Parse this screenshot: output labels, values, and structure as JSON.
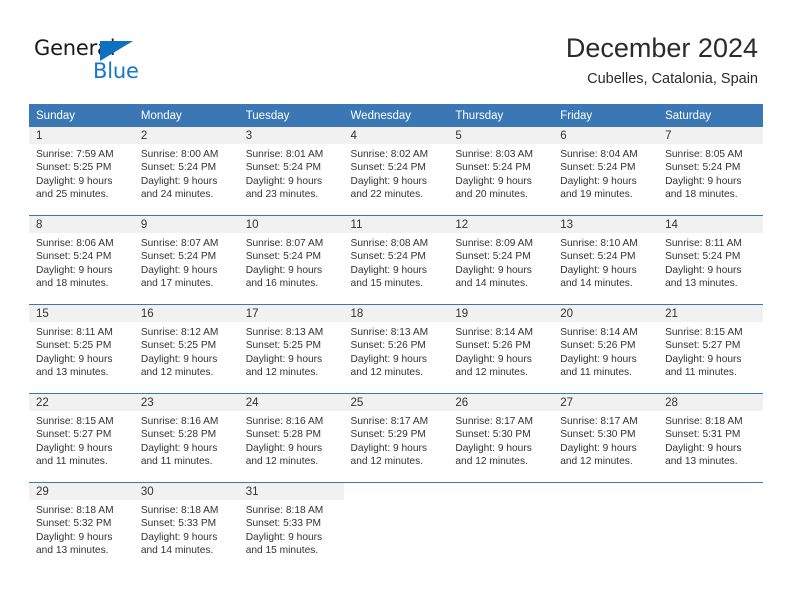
{
  "brand": {
    "name_part1": "General",
    "name_part2": "Blue",
    "triangle_color": "#0f6fc0",
    "blue_text_color": "#1878c8"
  },
  "header": {
    "month_title": "December 2024",
    "location": "Cubelles, Catalonia, Spain"
  },
  "colors": {
    "header_row_background": "#3a77b4",
    "header_row_text": "#ffffff",
    "daynum_band_background": "#f1f1f1",
    "cell_text": "#333333",
    "week_separator": "#3a77b4"
  },
  "weekdays": [
    {
      "label": "Sunday"
    },
    {
      "label": "Monday"
    },
    {
      "label": "Tuesday"
    },
    {
      "label": "Wednesday"
    },
    {
      "label": "Thursday"
    },
    {
      "label": "Friday"
    },
    {
      "label": "Saturday"
    }
  ],
  "weeks": [
    {
      "days": [
        {
          "date": "1",
          "sunrise": "Sunrise: 7:59 AM",
          "sunset": "Sunset: 5:25 PM",
          "daylight_line1": "Daylight: 9 hours",
          "daylight_line2": "and 25 minutes."
        },
        {
          "date": "2",
          "sunrise": "Sunrise: 8:00 AM",
          "sunset": "Sunset: 5:24 PM",
          "daylight_line1": "Daylight: 9 hours",
          "daylight_line2": "and 24 minutes."
        },
        {
          "date": "3",
          "sunrise": "Sunrise: 8:01 AM",
          "sunset": "Sunset: 5:24 PM",
          "daylight_line1": "Daylight: 9 hours",
          "daylight_line2": "and 23 minutes."
        },
        {
          "date": "4",
          "sunrise": "Sunrise: 8:02 AM",
          "sunset": "Sunset: 5:24 PM",
          "daylight_line1": "Daylight: 9 hours",
          "daylight_line2": "and 22 minutes."
        },
        {
          "date": "5",
          "sunrise": "Sunrise: 8:03 AM",
          "sunset": "Sunset: 5:24 PM",
          "daylight_line1": "Daylight: 9 hours",
          "daylight_line2": "and 20 minutes."
        },
        {
          "date": "6",
          "sunrise": "Sunrise: 8:04 AM",
          "sunset": "Sunset: 5:24 PM",
          "daylight_line1": "Daylight: 9 hours",
          "daylight_line2": "and 19 minutes."
        },
        {
          "date": "7",
          "sunrise": "Sunrise: 8:05 AM",
          "sunset": "Sunset: 5:24 PM",
          "daylight_line1": "Daylight: 9 hours",
          "daylight_line2": "and 18 minutes."
        }
      ]
    },
    {
      "days": [
        {
          "date": "8",
          "sunrise": "Sunrise: 8:06 AM",
          "sunset": "Sunset: 5:24 PM",
          "daylight_line1": "Daylight: 9 hours",
          "daylight_line2": "and 18 minutes."
        },
        {
          "date": "9",
          "sunrise": "Sunrise: 8:07 AM",
          "sunset": "Sunset: 5:24 PM",
          "daylight_line1": "Daylight: 9 hours",
          "daylight_line2": "and 17 minutes."
        },
        {
          "date": "10",
          "sunrise": "Sunrise: 8:07 AM",
          "sunset": "Sunset: 5:24 PM",
          "daylight_line1": "Daylight: 9 hours",
          "daylight_line2": "and 16 minutes."
        },
        {
          "date": "11",
          "sunrise": "Sunrise: 8:08 AM",
          "sunset": "Sunset: 5:24 PM",
          "daylight_line1": "Daylight: 9 hours",
          "daylight_line2": "and 15 minutes."
        },
        {
          "date": "12",
          "sunrise": "Sunrise: 8:09 AM",
          "sunset": "Sunset: 5:24 PM",
          "daylight_line1": "Daylight: 9 hours",
          "daylight_line2": "and 14 minutes."
        },
        {
          "date": "13",
          "sunrise": "Sunrise: 8:10 AM",
          "sunset": "Sunset: 5:24 PM",
          "daylight_line1": "Daylight: 9 hours",
          "daylight_line2": "and 14 minutes."
        },
        {
          "date": "14",
          "sunrise": "Sunrise: 8:11 AM",
          "sunset": "Sunset: 5:24 PM",
          "daylight_line1": "Daylight: 9 hours",
          "daylight_line2": "and 13 minutes."
        }
      ]
    },
    {
      "days": [
        {
          "date": "15",
          "sunrise": "Sunrise: 8:11 AM",
          "sunset": "Sunset: 5:25 PM",
          "daylight_line1": "Daylight: 9 hours",
          "daylight_line2": "and 13 minutes."
        },
        {
          "date": "16",
          "sunrise": "Sunrise: 8:12 AM",
          "sunset": "Sunset: 5:25 PM",
          "daylight_line1": "Daylight: 9 hours",
          "daylight_line2": "and 12 minutes."
        },
        {
          "date": "17",
          "sunrise": "Sunrise: 8:13 AM",
          "sunset": "Sunset: 5:25 PM",
          "daylight_line1": "Daylight: 9 hours",
          "daylight_line2": "and 12 minutes."
        },
        {
          "date": "18",
          "sunrise": "Sunrise: 8:13 AM",
          "sunset": "Sunset: 5:26 PM",
          "daylight_line1": "Daylight: 9 hours",
          "daylight_line2": "and 12 minutes."
        },
        {
          "date": "19",
          "sunrise": "Sunrise: 8:14 AM",
          "sunset": "Sunset: 5:26 PM",
          "daylight_line1": "Daylight: 9 hours",
          "daylight_line2": "and 12 minutes."
        },
        {
          "date": "20",
          "sunrise": "Sunrise: 8:14 AM",
          "sunset": "Sunset: 5:26 PM",
          "daylight_line1": "Daylight: 9 hours",
          "daylight_line2": "and 11 minutes."
        },
        {
          "date": "21",
          "sunrise": "Sunrise: 8:15 AM",
          "sunset": "Sunset: 5:27 PM",
          "daylight_line1": "Daylight: 9 hours",
          "daylight_line2": "and 11 minutes."
        }
      ]
    },
    {
      "days": [
        {
          "date": "22",
          "sunrise": "Sunrise: 8:15 AM",
          "sunset": "Sunset: 5:27 PM",
          "daylight_line1": "Daylight: 9 hours",
          "daylight_line2": "and 11 minutes."
        },
        {
          "date": "23",
          "sunrise": "Sunrise: 8:16 AM",
          "sunset": "Sunset: 5:28 PM",
          "daylight_line1": "Daylight: 9 hours",
          "daylight_line2": "and 11 minutes."
        },
        {
          "date": "24",
          "sunrise": "Sunrise: 8:16 AM",
          "sunset": "Sunset: 5:28 PM",
          "daylight_line1": "Daylight: 9 hours",
          "daylight_line2": "and 12 minutes."
        },
        {
          "date": "25",
          "sunrise": "Sunrise: 8:17 AM",
          "sunset": "Sunset: 5:29 PM",
          "daylight_line1": "Daylight: 9 hours",
          "daylight_line2": "and 12 minutes."
        },
        {
          "date": "26",
          "sunrise": "Sunrise: 8:17 AM",
          "sunset": "Sunset: 5:30 PM",
          "daylight_line1": "Daylight: 9 hours",
          "daylight_line2": "and 12 minutes."
        },
        {
          "date": "27",
          "sunrise": "Sunrise: 8:17 AM",
          "sunset": "Sunset: 5:30 PM",
          "daylight_line1": "Daylight: 9 hours",
          "daylight_line2": "and 12 minutes."
        },
        {
          "date": "28",
          "sunrise": "Sunrise: 8:18 AM",
          "sunset": "Sunset: 5:31 PM",
          "daylight_line1": "Daylight: 9 hours",
          "daylight_line2": "and 13 minutes."
        }
      ]
    },
    {
      "days": [
        {
          "date": "29",
          "sunrise": "Sunrise: 8:18 AM",
          "sunset": "Sunset: 5:32 PM",
          "daylight_line1": "Daylight: 9 hours",
          "daylight_line2": "and 13 minutes."
        },
        {
          "date": "30",
          "sunrise": "Sunrise: 8:18 AM",
          "sunset": "Sunset: 5:33 PM",
          "daylight_line1": "Daylight: 9 hours",
          "daylight_line2": "and 14 minutes."
        },
        {
          "date": "31",
          "sunrise": "Sunrise: 8:18 AM",
          "sunset": "Sunset: 5:33 PM",
          "daylight_line1": "Daylight: 9 hours",
          "daylight_line2": "and 15 minutes."
        },
        {
          "date": "",
          "sunrise": "",
          "sunset": "",
          "daylight_line1": "",
          "daylight_line2": ""
        },
        {
          "date": "",
          "sunrise": "",
          "sunset": "",
          "daylight_line1": "",
          "daylight_line2": ""
        },
        {
          "date": "",
          "sunrise": "",
          "sunset": "",
          "daylight_line1": "",
          "daylight_line2": ""
        },
        {
          "date": "",
          "sunrise": "",
          "sunset": "",
          "daylight_line1": "",
          "daylight_line2": ""
        }
      ]
    }
  ]
}
